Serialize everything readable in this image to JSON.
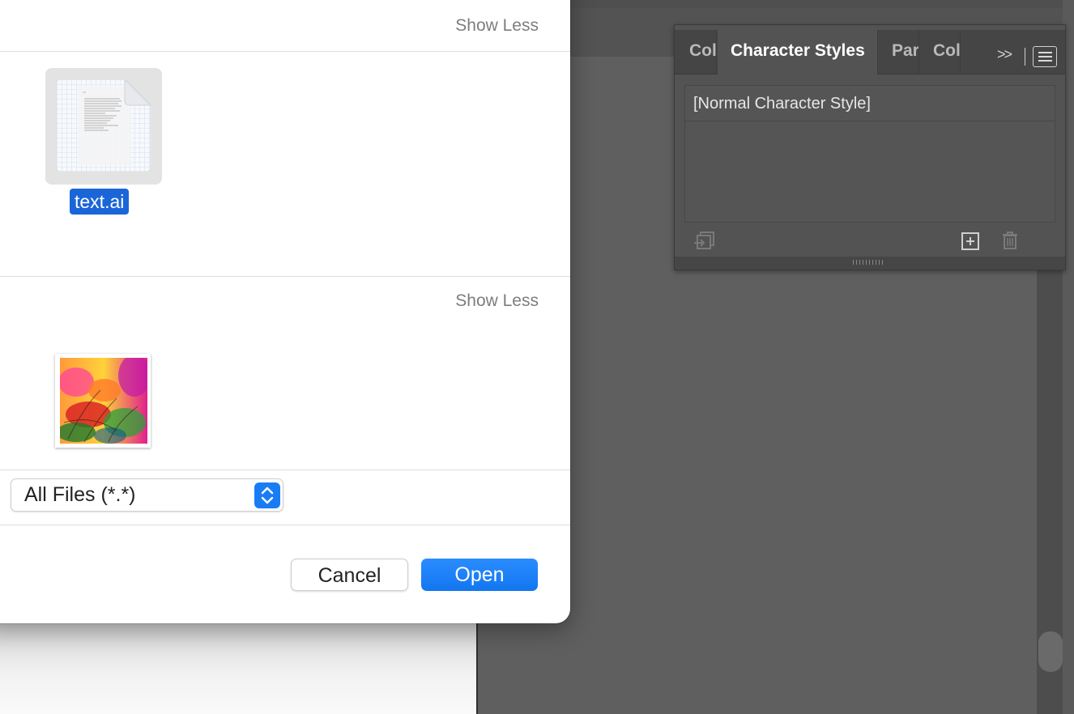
{
  "dialog": {
    "section1": {
      "show_less_label": "Show Less"
    },
    "section2": {
      "show_less_label": "Show Less"
    },
    "files": [
      {
        "name": "text.ai",
        "selected": true,
        "icon": "document-icon"
      },
      {
        "name": "",
        "icon": "image-thumbnail"
      }
    ],
    "file_type_filter": {
      "selected": "All Files (*.*)"
    },
    "buttons": {
      "cancel": "Cancel",
      "open": "Open"
    },
    "colors": {
      "accent": "#1a66d9",
      "open_button": "#1276f0"
    }
  },
  "character_panel": {
    "tabs": [
      {
        "label": "Col",
        "active": false
      },
      {
        "label": "Character Styles",
        "active": true
      },
      {
        "label": "Par",
        "active": false
      },
      {
        "label": "Col",
        "active": false
      }
    ],
    "overflow_label": ">>",
    "styles": [
      "[Normal Character Style]"
    ],
    "footer_icons": [
      "load-styles-icon",
      "new-style-icon",
      "delete-style-icon"
    ]
  }
}
